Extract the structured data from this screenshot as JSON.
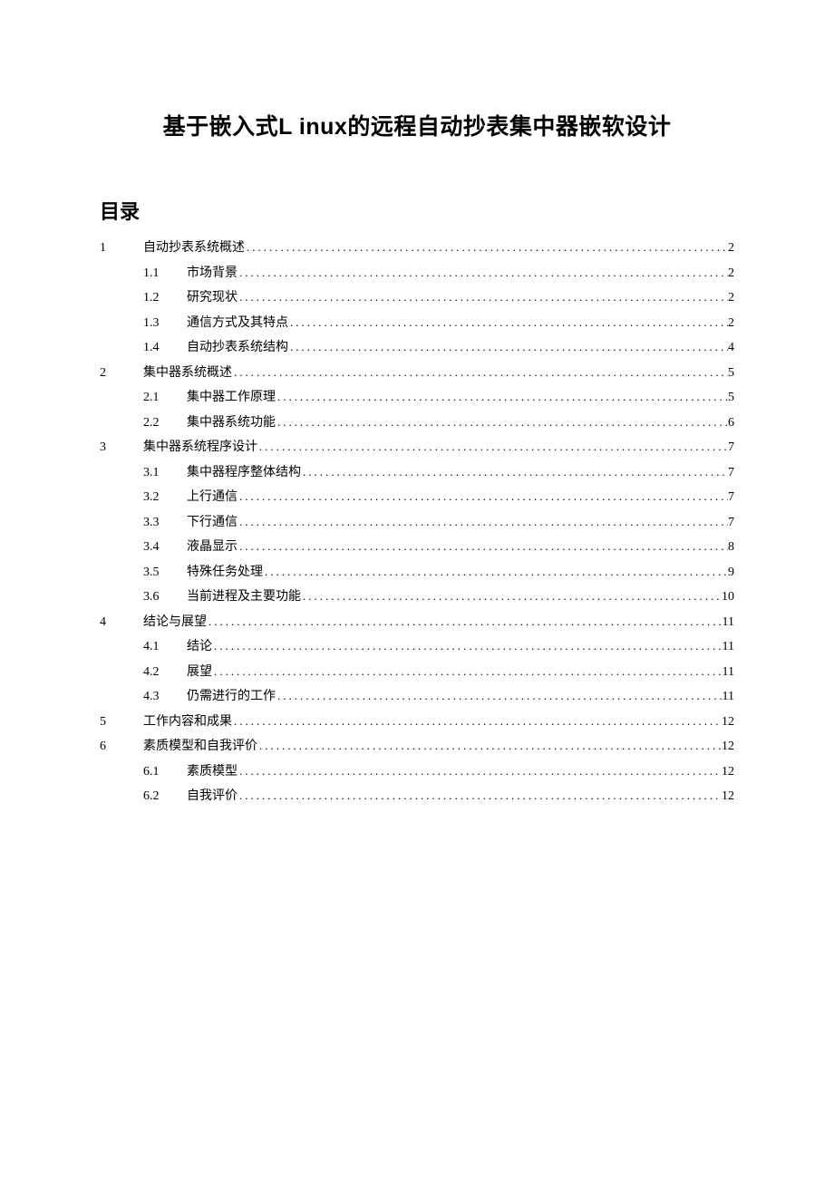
{
  "title": "基于嵌入式L inux的远程自动抄表集中器嵌软设计",
  "tocHeading": "目录",
  "toc": [
    {
      "level": 1,
      "num": "1",
      "text": "自动抄表系统概述",
      "page": "2"
    },
    {
      "level": 2,
      "num": "1.1",
      "text": "市场背景",
      "page": "2"
    },
    {
      "level": 2,
      "num": "1.2",
      "text": "研究现状",
      "page": "2"
    },
    {
      "level": 2,
      "num": "1.3",
      "text": "通信方式及其特点",
      "page": "2"
    },
    {
      "level": 2,
      "num": "1.4",
      "text": "自动抄表系统结构",
      "page": "4"
    },
    {
      "level": 1,
      "num": "2",
      "text": "集中器系统概述",
      "page": "5"
    },
    {
      "level": 2,
      "num": "2.1",
      "text": "集中器工作原理",
      "page": "5"
    },
    {
      "level": 2,
      "num": "2.2",
      "text": "集中器系统功能",
      "page": "6"
    },
    {
      "level": 1,
      "num": "3",
      "text": "集中器系统程序设计",
      "page": "7"
    },
    {
      "level": 2,
      "num": "3.1",
      "text": "集中器程序整体结构",
      "page": "7"
    },
    {
      "level": 2,
      "num": "3.2",
      "text": "上行通信",
      "page": "7"
    },
    {
      "level": 2,
      "num": "3.3",
      "text": "下行通信",
      "page": "7"
    },
    {
      "level": 2,
      "num": "3.4",
      "text": "液晶显示",
      "page": "8"
    },
    {
      "level": 2,
      "num": "3.5",
      "text": "特殊任务处理",
      "page": "9"
    },
    {
      "level": 2,
      "num": "3.6",
      "text": "当前进程及主要功能",
      "page": "10"
    },
    {
      "level": 1,
      "num": "4",
      "text": "结论与展望",
      "page": "11"
    },
    {
      "level": 2,
      "num": "4.1",
      "text": "结论",
      "page": "11"
    },
    {
      "level": 2,
      "num": "4.2",
      "text": "展望",
      "page": "11"
    },
    {
      "level": 2,
      "num": "4.3",
      "text": "仍需进行的工作",
      "page": "11"
    },
    {
      "level": 1,
      "num": "5",
      "text": "工作内容和成果",
      "page": "12"
    },
    {
      "level": 1,
      "num": "6",
      "text": "素质模型和自我评价",
      "page": "12"
    },
    {
      "level": 2,
      "num": "6.1",
      "text": "素质模型",
      "page": "12"
    },
    {
      "level": 2,
      "num": "6.2",
      "text": "自我评价",
      "page": "12"
    }
  ]
}
